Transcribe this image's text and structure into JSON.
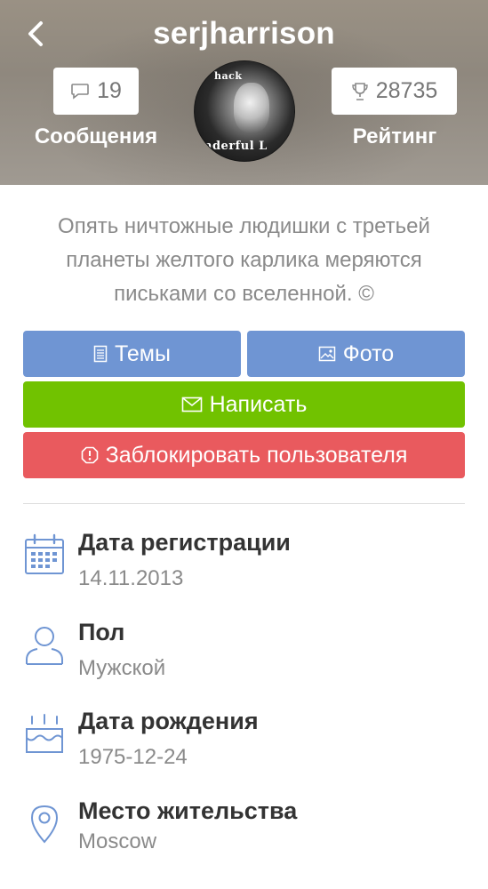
{
  "header": {
    "username": "serjharrison",
    "messages_count": "19",
    "messages_label": "Сообщения",
    "rating_value": "28735",
    "rating_label": "Рейтинг",
    "avatar_text_top": "hack",
    "avatar_text_bottom": "nderful L"
  },
  "status_text": "Опять ничтожные людишки с третьей планеты желтого карлика меряются письками со вселенной. ©",
  "buttons": {
    "topics": "Темы",
    "photos": "Фото",
    "write": "Написать",
    "block": "Заблокировать пользователя"
  },
  "colors": {
    "blue_button": "#6f95d3",
    "green_button": "#71c200",
    "red_button": "#e95a5e",
    "icon_blue": "#6f95d3"
  },
  "info": [
    {
      "icon": "calendar-icon",
      "title": "Дата регистрации",
      "value": "14.11.2013"
    },
    {
      "icon": "user-icon",
      "title": "Пол",
      "value": "Мужской"
    },
    {
      "icon": "cake-icon",
      "title": "Дата рождения",
      "value": "1975-12-24"
    },
    {
      "icon": "location-pin-icon",
      "title": "Место жительства",
      "value": "Moscow"
    }
  ]
}
